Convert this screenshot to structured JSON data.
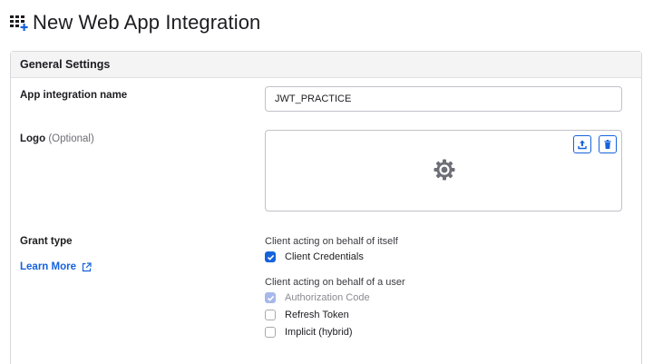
{
  "header": {
    "title": "New Web App Integration",
    "icon": "grid-plus-icon"
  },
  "general_settings": {
    "section_title": "General Settings",
    "app_name": {
      "label": "App integration name",
      "value": "JWT_PRACTICE"
    },
    "logo": {
      "label": "Logo",
      "optional_hint": "(Optional)",
      "upload_icon": "upload-icon",
      "delete_icon": "trash-icon",
      "placeholder_icon": "gear-icon"
    },
    "grant_type": {
      "label": "Grant type",
      "learn_more": "Learn More",
      "groups": [
        {
          "label": "Client acting on behalf of itself",
          "options": [
            {
              "label": "Client Credentials",
              "checked": true,
              "disabled": false
            }
          ]
        },
        {
          "label": "Client acting on behalf of a user",
          "options": [
            {
              "label": "Authorization Code",
              "checked": true,
              "disabled": true
            },
            {
              "label": "Refresh Token",
              "checked": false,
              "disabled": false
            },
            {
              "label": "Implicit (hybrid)",
              "checked": false,
              "disabled": false
            }
          ]
        }
      ]
    }
  },
  "colors": {
    "accent": "#1662dd",
    "disabled_check": "#a7b8ea",
    "border": "#c1c1c8",
    "section_header_bg": "#f4f4f5"
  }
}
